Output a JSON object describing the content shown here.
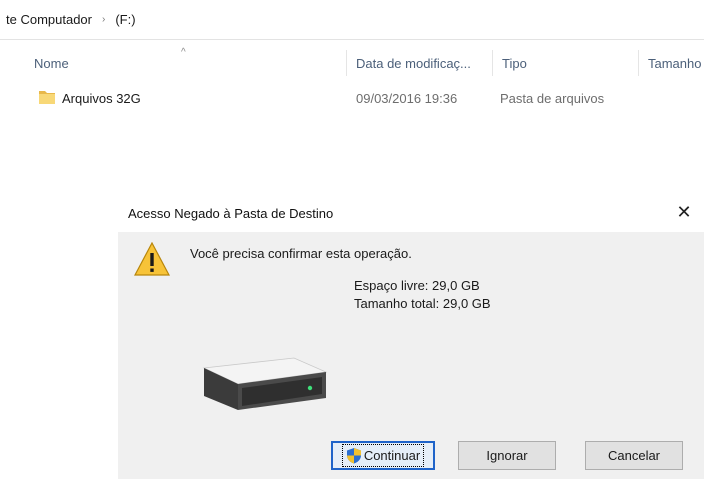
{
  "breadcrumb": {
    "items": [
      "te Computador",
      "(F:)"
    ],
    "separator": "›"
  },
  "columns": {
    "name": "Nome",
    "date": "Data de modificaç...",
    "type": "Tipo",
    "size": "Tamanho",
    "sort_indicator": "^"
  },
  "files": [
    {
      "name": "Arquivos 32G",
      "date": "09/03/2016 19:36",
      "type": "Pasta de arquivos",
      "icon": "folder-icon"
    }
  ],
  "dialog": {
    "title": "Acesso Negado à Pasta de Destino",
    "close_glyph": "✕",
    "message": "Você precisa confirmar esta operação.",
    "free_space": "Espaço livre: 29,0 GB",
    "total_size": "Tamanho total: 29,0 GB",
    "buttons": {
      "continue": "Continuar",
      "ignore": "Ignorar",
      "cancel": "Cancelar"
    }
  },
  "colors": {
    "header_text": "#4c607a",
    "dialog_body": "#f0f0f0",
    "accent": "#1e63c9",
    "folder": "#f5cf6a",
    "warning": "#f7c338"
  }
}
